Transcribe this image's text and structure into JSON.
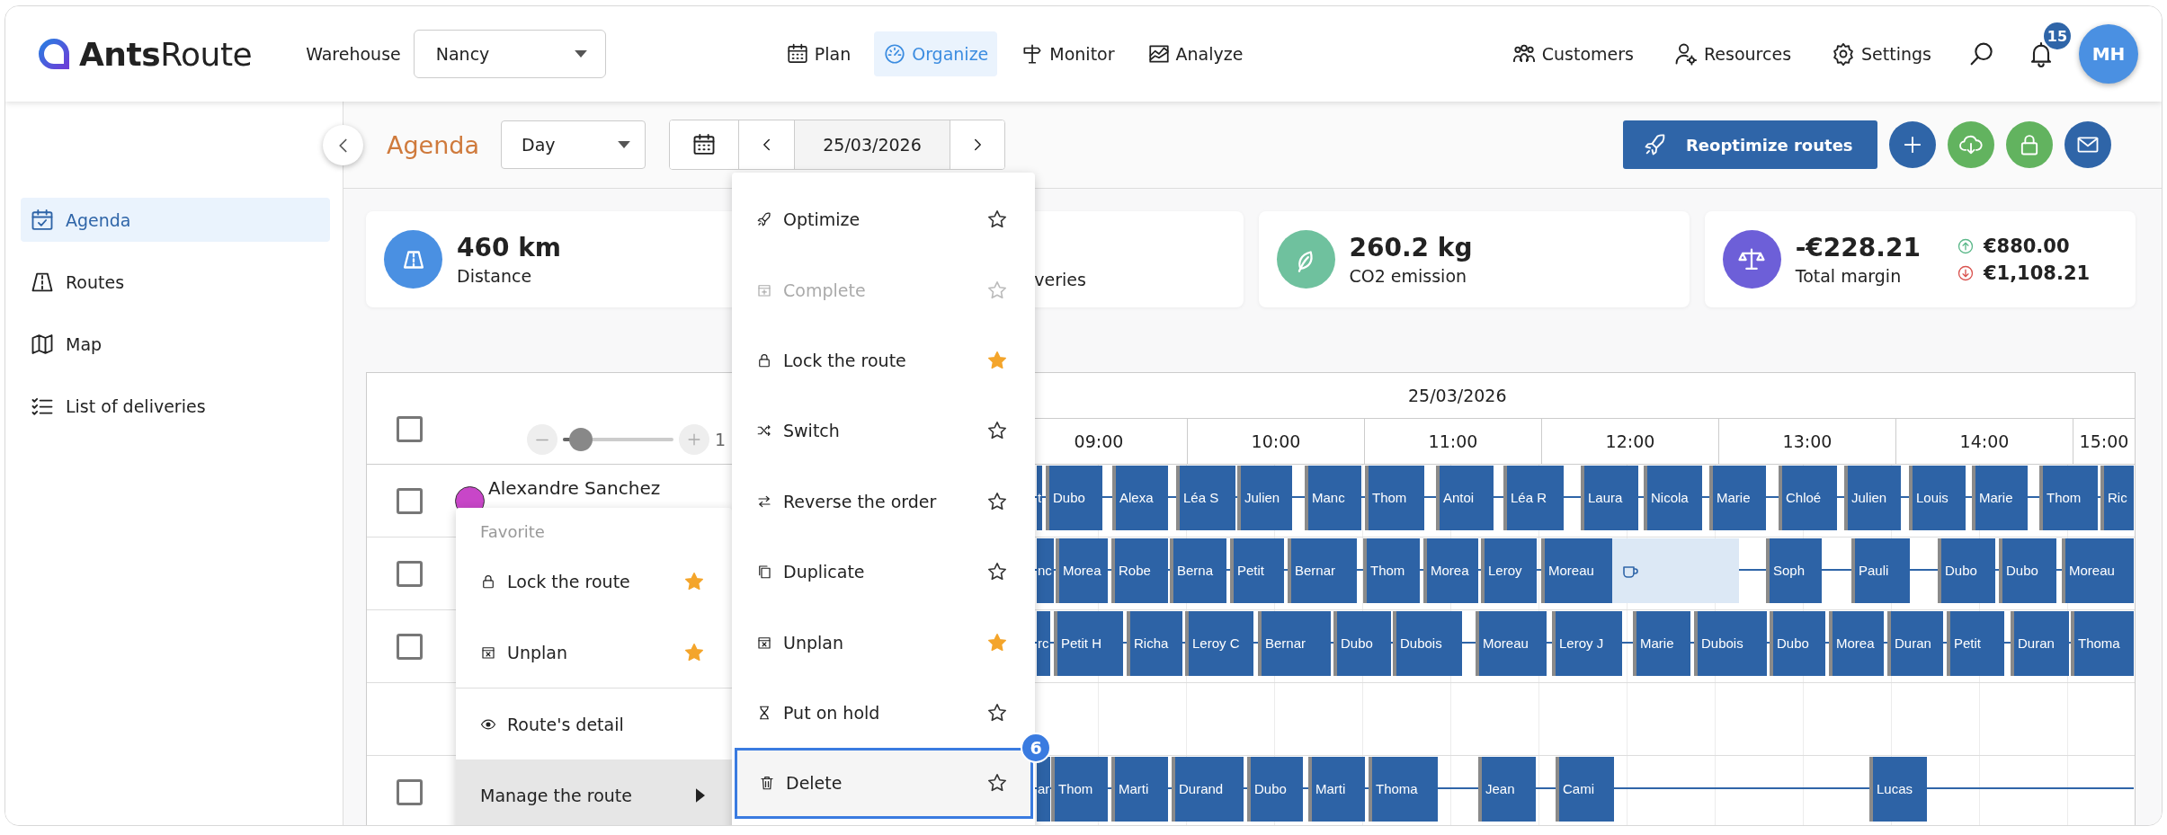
{
  "header": {
    "logo": "**Ants**Route",
    "warehouse_label": "Warehouse",
    "warehouse": "Nancy",
    "nav": [
      {
        "label": "Plan",
        "selected": false
      },
      {
        "label": "Organize",
        "selected": true
      },
      {
        "label": "Monitor",
        "selected": false
      },
      {
        "label": "Analyze",
        "selected": false
      }
    ],
    "tools": [
      {
        "label": "Customers"
      },
      {
        "label": "Resources"
      },
      {
        "label": "Settings"
      }
    ],
    "notifications": "15",
    "avatar": "MH"
  },
  "sidebar": {
    "items": [
      {
        "label": "Agenda",
        "selected": true
      },
      {
        "label": "Routes",
        "selected": false
      },
      {
        "label": "Map",
        "selected": false
      },
      {
        "label": "List of deliveries",
        "selected": false
      }
    ]
  },
  "toolbar": {
    "title": "Agenda",
    "view": "Day",
    "date": "25/03/2026",
    "primary_action": "Reoptimize routes"
  },
  "kpis": [
    {
      "value": "460 km",
      "label": "Distance",
      "color": "#4a90e2"
    },
    {
      "label": "veries"
    },
    {
      "value": "260.2 kg",
      "label": "CO2 emission",
      "color": "#6fc19e"
    },
    {
      "value": "-€228.21",
      "label": "Total margin",
      "color": "#6d5fd8",
      "changes": [
        {
          "kind": "up",
          "value": "€880.00"
        },
        {
          "kind": "down",
          "value": "€1,108.21"
        }
      ]
    }
  ],
  "gantt": {
    "all_checked": false,
    "zoom": {
      "level": 0.16,
      "reading": "1"
    },
    "date": "25/03/2026",
    "hours": [
      "09:00",
      "10:00",
      "11:00",
      "12:00",
      "13:00",
      "14:00",
      "15:00"
    ],
    "rows": [
      {
        "kind": "route",
        "checked": false,
        "driver": "Alexandre Sanchez",
        "color": "#c846c8",
        "stops": [
          {
            "kind": "stop",
            "label": "t"
          },
          {
            "kind": "stop",
            "label": "Dubo"
          },
          {
            "kind": "stop",
            "label": "Alexa"
          },
          {
            "kind": "stop",
            "label": "Léa S"
          },
          {
            "kind": "stop",
            "label": "Julien"
          },
          {
            "kind": "stop",
            "label": "Manc"
          },
          {
            "kind": "stop",
            "label": "Thom"
          },
          {
            "kind": "stop",
            "label": "Antoi"
          },
          {
            "kind": "stop",
            "label": "Léa R"
          },
          {
            "kind": "stop",
            "label": "Laura"
          },
          {
            "kind": "stop",
            "label": "Nicola"
          },
          {
            "kind": "stop",
            "label": "Marie"
          },
          {
            "kind": "stop",
            "label": "Chloé"
          },
          {
            "kind": "stop",
            "label": "Julien"
          },
          {
            "kind": "stop",
            "label": "Louis"
          },
          {
            "kind": "stop",
            "label": "Marie"
          },
          {
            "kind": "stop",
            "label": "Thom"
          },
          {
            "kind": "stop",
            "label": "Ric"
          }
        ]
      },
      {
        "kind": "route",
        "checked": false,
        "stops": [
          {
            "kind": "stop",
            "label": "nc"
          },
          {
            "kind": "stop",
            "label": "Morea"
          },
          {
            "kind": "stop",
            "label": "Robe"
          },
          {
            "kind": "stop",
            "label": "Berna"
          },
          {
            "kind": "stop",
            "label": "Petit"
          },
          {
            "kind": "stop",
            "label": "Bernar"
          },
          {
            "kind": "stop",
            "label": "Thom"
          },
          {
            "kind": "stop",
            "label": "Morea"
          },
          {
            "kind": "stop",
            "label": "Leroy"
          },
          {
            "kind": "stop",
            "label": "Moreau"
          },
          {
            "kind": "break"
          },
          {
            "kind": "stop",
            "label": "Soph"
          },
          {
            "kind": "stop",
            "label": "Pauli"
          },
          {
            "kind": "stop",
            "label": "Dubo"
          },
          {
            "kind": "stop",
            "label": "Dubo"
          },
          {
            "kind": "stop",
            "label": "Moreau"
          }
        ]
      },
      {
        "kind": "route",
        "checked": false,
        "stops": [
          {
            "kind": "stop",
            "label": "rc"
          },
          {
            "kind": "stop",
            "label": "Petit H"
          },
          {
            "kind": "stop",
            "label": "Richa"
          },
          {
            "kind": "stop",
            "label": "Leroy C"
          },
          {
            "kind": "stop",
            "label": "Bernar"
          },
          {
            "kind": "stop",
            "label": "Dubo"
          },
          {
            "kind": "stop",
            "label": "Dubois"
          },
          {
            "kind": "stop",
            "label": "Moreau"
          },
          {
            "kind": "stop",
            "label": "Leroy J"
          },
          {
            "kind": "stop",
            "label": "Marie"
          },
          {
            "kind": "stop",
            "label": "Dubois"
          },
          {
            "kind": "stop",
            "label": "Dubo"
          },
          {
            "kind": "stop",
            "label": "Morea"
          },
          {
            "kind": "stop",
            "label": "Duran"
          },
          {
            "kind": "stop",
            "label": "Petit"
          },
          {
            "kind": "stop",
            "label": "Duran"
          },
          {
            "kind": "stop",
            "label": "Thoma"
          }
        ]
      },
      {
        "kind": "blank"
      },
      {
        "kind": "route",
        "checked": false,
        "stops": [
          {
            "kind": "stop",
            "label": "ar"
          },
          {
            "kind": "stop",
            "label": "Thom"
          },
          {
            "kind": "stop",
            "label": "Marti"
          },
          {
            "kind": "stop",
            "label": "Durand"
          },
          {
            "kind": "stop",
            "label": "Dubo"
          },
          {
            "kind": "stop",
            "label": "Marti"
          },
          {
            "kind": "stop",
            "label": "Thoma"
          },
          {
            "kind": "stop",
            "label": "Jean"
          },
          {
            "kind": "stop",
            "label": "Cami"
          },
          {
            "kind": "stop",
            "label": "Lucas"
          }
        ]
      }
    ]
  },
  "route_menu": {
    "items": [
      {
        "kind": "header",
        "label": "Favorite"
      },
      {
        "kind": "favorite",
        "label": "Lock the route",
        "starred": true,
        "selected": false
      },
      {
        "kind": "favorite",
        "label": "Unplan",
        "starred": true,
        "selected": false
      },
      {
        "kind": "link",
        "label": "Route's detail",
        "selected": false
      },
      {
        "kind": "submenu",
        "label": "Manage the route",
        "selected": true
      }
    ]
  },
  "manage_submenu": {
    "step_badge": "6",
    "items": [
      {
        "label": "Optimize",
        "starred": false,
        "disabled": false,
        "selected": false
      },
      {
        "label": "Complete",
        "starred": false,
        "disabled": true,
        "selected": false
      },
      {
        "label": "Lock the route",
        "starred": true,
        "disabled": false,
        "selected": false
      },
      {
        "label": "Switch",
        "starred": false,
        "disabled": false,
        "selected": false
      },
      {
        "label": "Reverse the order",
        "starred": false,
        "disabled": false,
        "selected": false
      },
      {
        "label": "Duplicate",
        "starred": false,
        "disabled": false,
        "selected": false
      },
      {
        "label": "Unplan",
        "starred": true,
        "disabled": false,
        "selected": false
      },
      {
        "label": "Put on hold",
        "starred": false,
        "disabled": false,
        "selected": false
      },
      {
        "label": "Delete",
        "starred": false,
        "disabled": false,
        "selected": true
      }
    ]
  }
}
